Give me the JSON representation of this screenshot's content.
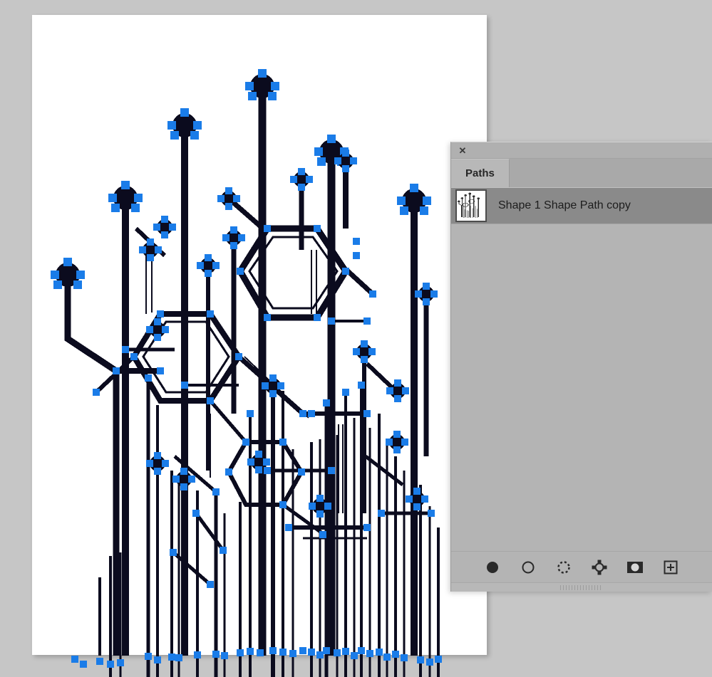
{
  "app": {
    "background_color": "#c6c6c6",
    "canvas_color": "#ffffff"
  },
  "canvas": {
    "name": "document-canvas",
    "artwork": {
      "title": "circuit-board tree path outlines",
      "stroke_color": "#0b0b1e",
      "anchor_color": "#1a7ce8",
      "description": "Vector path of a stylized circuit-board tree with visible blue path anchor points"
    }
  },
  "paths_panel": {
    "close_label": "✕",
    "tabs": [
      {
        "label": "Paths",
        "active": true
      }
    ],
    "rows": [
      {
        "label": "Shape 1 Shape Path copy",
        "selected": true
      }
    ],
    "footer_buttons": [
      {
        "name": "fill-path-with-foreground-color",
        "icon": "filled-circle-icon"
      },
      {
        "name": "stroke-path-with-brush",
        "icon": "circle-outline-icon"
      },
      {
        "name": "load-path-as-selection",
        "icon": "dashed-circle-icon"
      },
      {
        "name": "make-work-path-from-selection",
        "icon": "anchor-points-icon"
      },
      {
        "name": "add-layer-mask",
        "icon": "mask-icon"
      },
      {
        "name": "create-new-path",
        "icon": "plus-square-icon"
      }
    ],
    "colors": {
      "panel_bg": "#b4b4b4",
      "tab_active_bg": "#b8b8b8",
      "row_selected_bg": "#8a8a8a",
      "text": "#1d1d1d"
    }
  }
}
